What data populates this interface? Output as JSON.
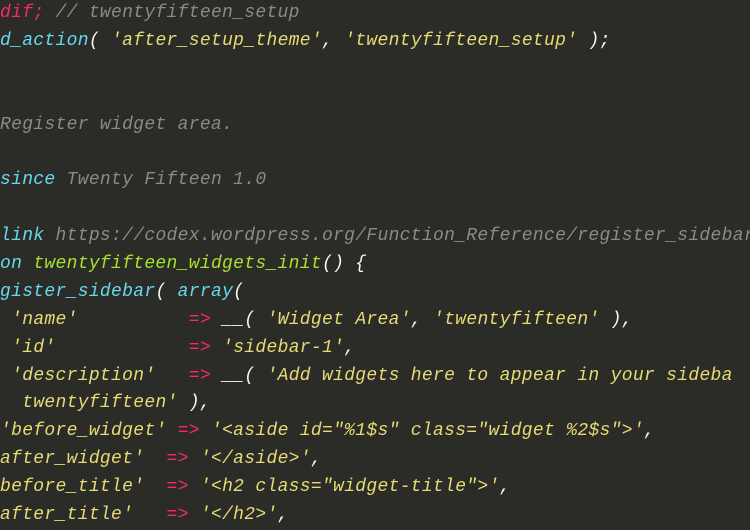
{
  "code": {
    "line1_endif": "dif;",
    "line1_comment": " // twentyfifteen_setup",
    "line2_fn": "d_action",
    "line2_p1": "( ",
    "line2_s1": "'after_setup_theme'",
    "line2_sep": ", ",
    "line2_s2": "'twentyfifteen_setup'",
    "line2_p2": " );",
    "doc_register": "Register widget area.",
    "doc_since_tag": "since",
    "doc_since_txt": " Twenty Fifteen 1.0",
    "doc_link_tag": "link",
    "doc_link_txt": " https://codex.wordpress.org/Function_Reference/register_sidebar",
    "fn_kw": "on ",
    "fn_name": "twentyfifteen_widgets_init",
    "fn_sig": "() {",
    "reg_fn": "gister_sidebar",
    "reg_p1": "( ",
    "reg_arrkw": "array",
    "reg_p2": "(",
    "arr_name_key": "'name'",
    "arr_name_sp": "          ",
    "arrow": "=>",
    "arr_name_fn": " __( ",
    "arr_name_s1": "'Widget Area'",
    "arr_name_sep": ", ",
    "arr_name_s2": "'twentyfifteen'",
    "arr_name_end": " ),",
    "arr_id_key": "'id'",
    "arr_id_sp": "            ",
    "arr_id_val": " 'sidebar-1'",
    "arr_id_end": ",",
    "arr_desc_key": "'description'",
    "arr_desc_sp": "   ",
    "arr_desc_fn": " __( ",
    "arr_desc_s1": "'Add widgets here to appear in your sideba",
    "arr_desc_s2": "twentyfifteen'",
    "arr_desc_end": " ),",
    "arr_bw_key": "'before_widget'",
    "arr_bw_sp": " ",
    "arr_bw_val": " '<aside id=\"%1$s\" class=\"widget %2$s\">'",
    "arr_bw_end": ",",
    "arr_aw_key": "after_widget'",
    "arr_aw_sp": "  ",
    "arr_aw_val": " '</aside>'",
    "arr_aw_end": ",",
    "arr_bt_key": "before_title'",
    "arr_bt_sp": "  ",
    "arr_bt_val": " '<h2 class=\"widget-title\">'",
    "arr_bt_end": ",",
    "arr_at_key": "after_title'",
    "arr_at_sp": "   ",
    "arr_at_val": " '</h2>'",
    "arr_at_end": ","
  }
}
